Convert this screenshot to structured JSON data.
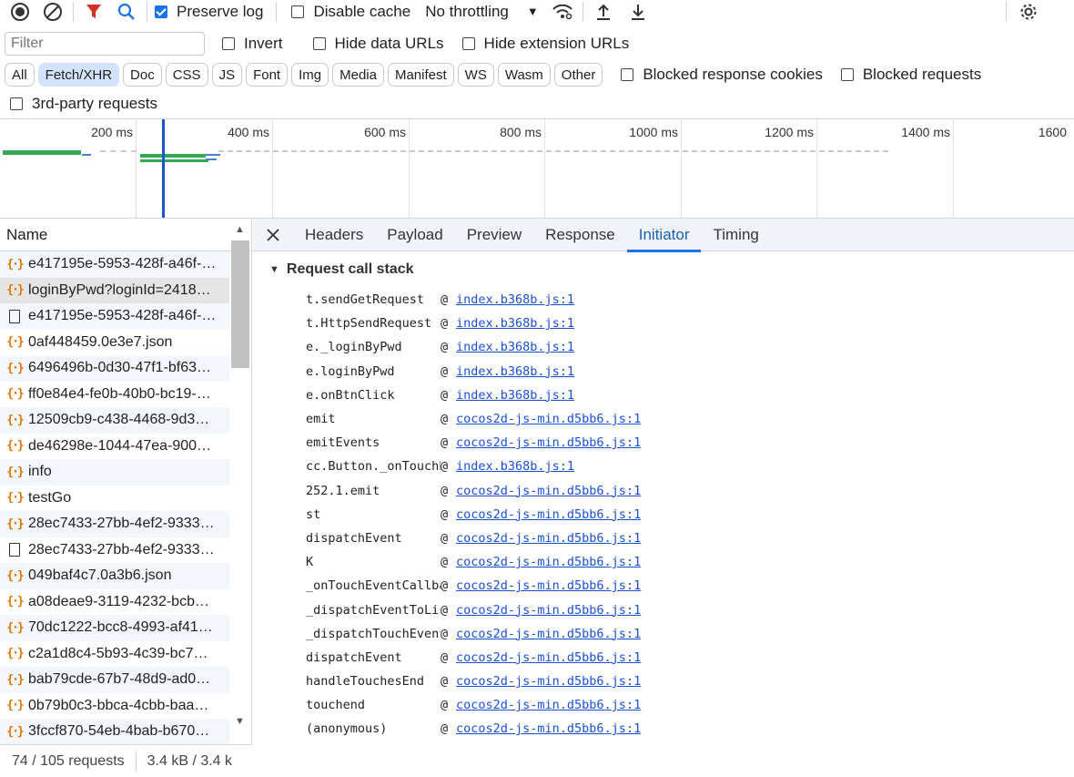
{
  "toolbar": {
    "preserve_log": "Preserve log",
    "disable_cache": "Disable cache",
    "throttling": "No throttling"
  },
  "filterbar": {
    "filter_placeholder": "Filter",
    "invert": "Invert",
    "hide_data_urls": "Hide data URLs",
    "hide_extension_urls": "Hide extension URLs"
  },
  "types": [
    "All",
    "Fetch/XHR",
    "Doc",
    "CSS",
    "JS",
    "Font",
    "Img",
    "Media",
    "Manifest",
    "WS",
    "Wasm",
    "Other"
  ],
  "typebar": {
    "blocked_response_cookies": "Blocked response cookies",
    "blocked_requests": "Blocked requests",
    "third_party": "3rd-party requests"
  },
  "timeline": {
    "ticks": [
      "200 ms",
      "400 ms",
      "600 ms",
      "800 ms",
      "1000 ms",
      "1200 ms",
      "1400 ms",
      "1600"
    ]
  },
  "requests": {
    "header": "Name",
    "items": [
      {
        "name": "e417195e-5953-428f-a46f-…",
        "type": "xhr"
      },
      {
        "name": "loginByPwd?loginId=2418…",
        "type": "xhr"
      },
      {
        "name": "e417195e-5953-428f-a46f-…",
        "type": "doc"
      },
      {
        "name": "0af448459.0e3e7.json",
        "type": "xhr"
      },
      {
        "name": "6496496b-0d30-47f1-bf63…",
        "type": "xhr"
      },
      {
        "name": "ff0e84e4-fe0b-40b0-bc19-…",
        "type": "xhr"
      },
      {
        "name": "12509cb9-c438-4468-9d3…",
        "type": "xhr"
      },
      {
        "name": "de46298e-1044-47ea-900…",
        "type": "xhr"
      },
      {
        "name": "info",
        "type": "xhr"
      },
      {
        "name": "testGo",
        "type": "xhr"
      },
      {
        "name": "28ec7433-27bb-4ef2-9333…",
        "type": "xhr"
      },
      {
        "name": "28ec7433-27bb-4ef2-9333…",
        "type": "doc"
      },
      {
        "name": "049baf4c7.0a3b6.json",
        "type": "xhr"
      },
      {
        "name": "a08deae9-3119-4232-bcb…",
        "type": "xhr"
      },
      {
        "name": "70dc1222-bcc8-4993-af41…",
        "type": "xhr"
      },
      {
        "name": "c2a1d8c4-5b93-4c39-bc7…",
        "type": "xhr"
      },
      {
        "name": "bab79cde-67b7-48d9-ad0…",
        "type": "xhr"
      },
      {
        "name": "0b79b0c3-bbca-4cbb-baa…",
        "type": "xhr"
      },
      {
        "name": "3fccf870-54eb-4bab-b670…",
        "type": "xhr"
      }
    ],
    "status_count": "74 / 105 requests",
    "status_size": "3.4 kB / 3.4 k"
  },
  "details": {
    "tabs": [
      "Headers",
      "Payload",
      "Preview",
      "Response",
      "Initiator",
      "Timing"
    ],
    "section": "Request call stack",
    "frames": [
      {
        "fn": "t.sendGetRequest",
        "src": "index.b368b.js:1"
      },
      {
        "fn": "t.HttpSendRequest",
        "src": "index.b368b.js:1"
      },
      {
        "fn": "e._loginByPwd",
        "src": "index.b368b.js:1"
      },
      {
        "fn": "e.loginByPwd",
        "src": "index.b368b.js:1"
      },
      {
        "fn": "e.onBtnClick",
        "src": "index.b368b.js:1"
      },
      {
        "fn": "emit",
        "src": "cocos2d-js-min.d5bb6.js:1"
      },
      {
        "fn": "emitEvents",
        "src": "cocos2d-js-min.d5bb6.js:1"
      },
      {
        "fn": "cc.Button._onTouchEnded",
        "src": "index.b368b.js:1"
      },
      {
        "fn": "252.1.emit",
        "src": "cocos2d-js-min.d5bb6.js:1"
      },
      {
        "fn": "st",
        "src": "cocos2d-js-min.d5bb6.js:1"
      },
      {
        "fn": "dispatchEvent",
        "src": "cocos2d-js-min.d5bb6.js:1"
      },
      {
        "fn": "K",
        "src": "cocos2d-js-min.d5bb6.js:1"
      },
      {
        "fn": "_onTouchEventCallback",
        "src": "cocos2d-js-min.d5bb6.js:1"
      },
      {
        "fn": "_dispatchEventToListeners",
        "src": "cocos2d-js-min.d5bb6.js:1"
      },
      {
        "fn": "_dispatchTouchEvent",
        "src": "cocos2d-js-min.d5bb6.js:1"
      },
      {
        "fn": "dispatchEvent",
        "src": "cocos2d-js-min.d5bb6.js:1"
      },
      {
        "fn": "handleTouchesEnd",
        "src": "cocos2d-js-min.d5bb6.js:1"
      },
      {
        "fn": "touchend",
        "src": "cocos2d-js-min.d5bb6.js:1"
      },
      {
        "fn": "(anonymous)",
        "src": "cocos2d-js-min.d5bb6.js:1"
      }
    ]
  },
  "colors": {
    "accent": "#1a73e8",
    "link": "#1a4fd6",
    "filter_red": "#d93025",
    "xhr_icon": "#e37400",
    "bar_green": "#34a853"
  }
}
